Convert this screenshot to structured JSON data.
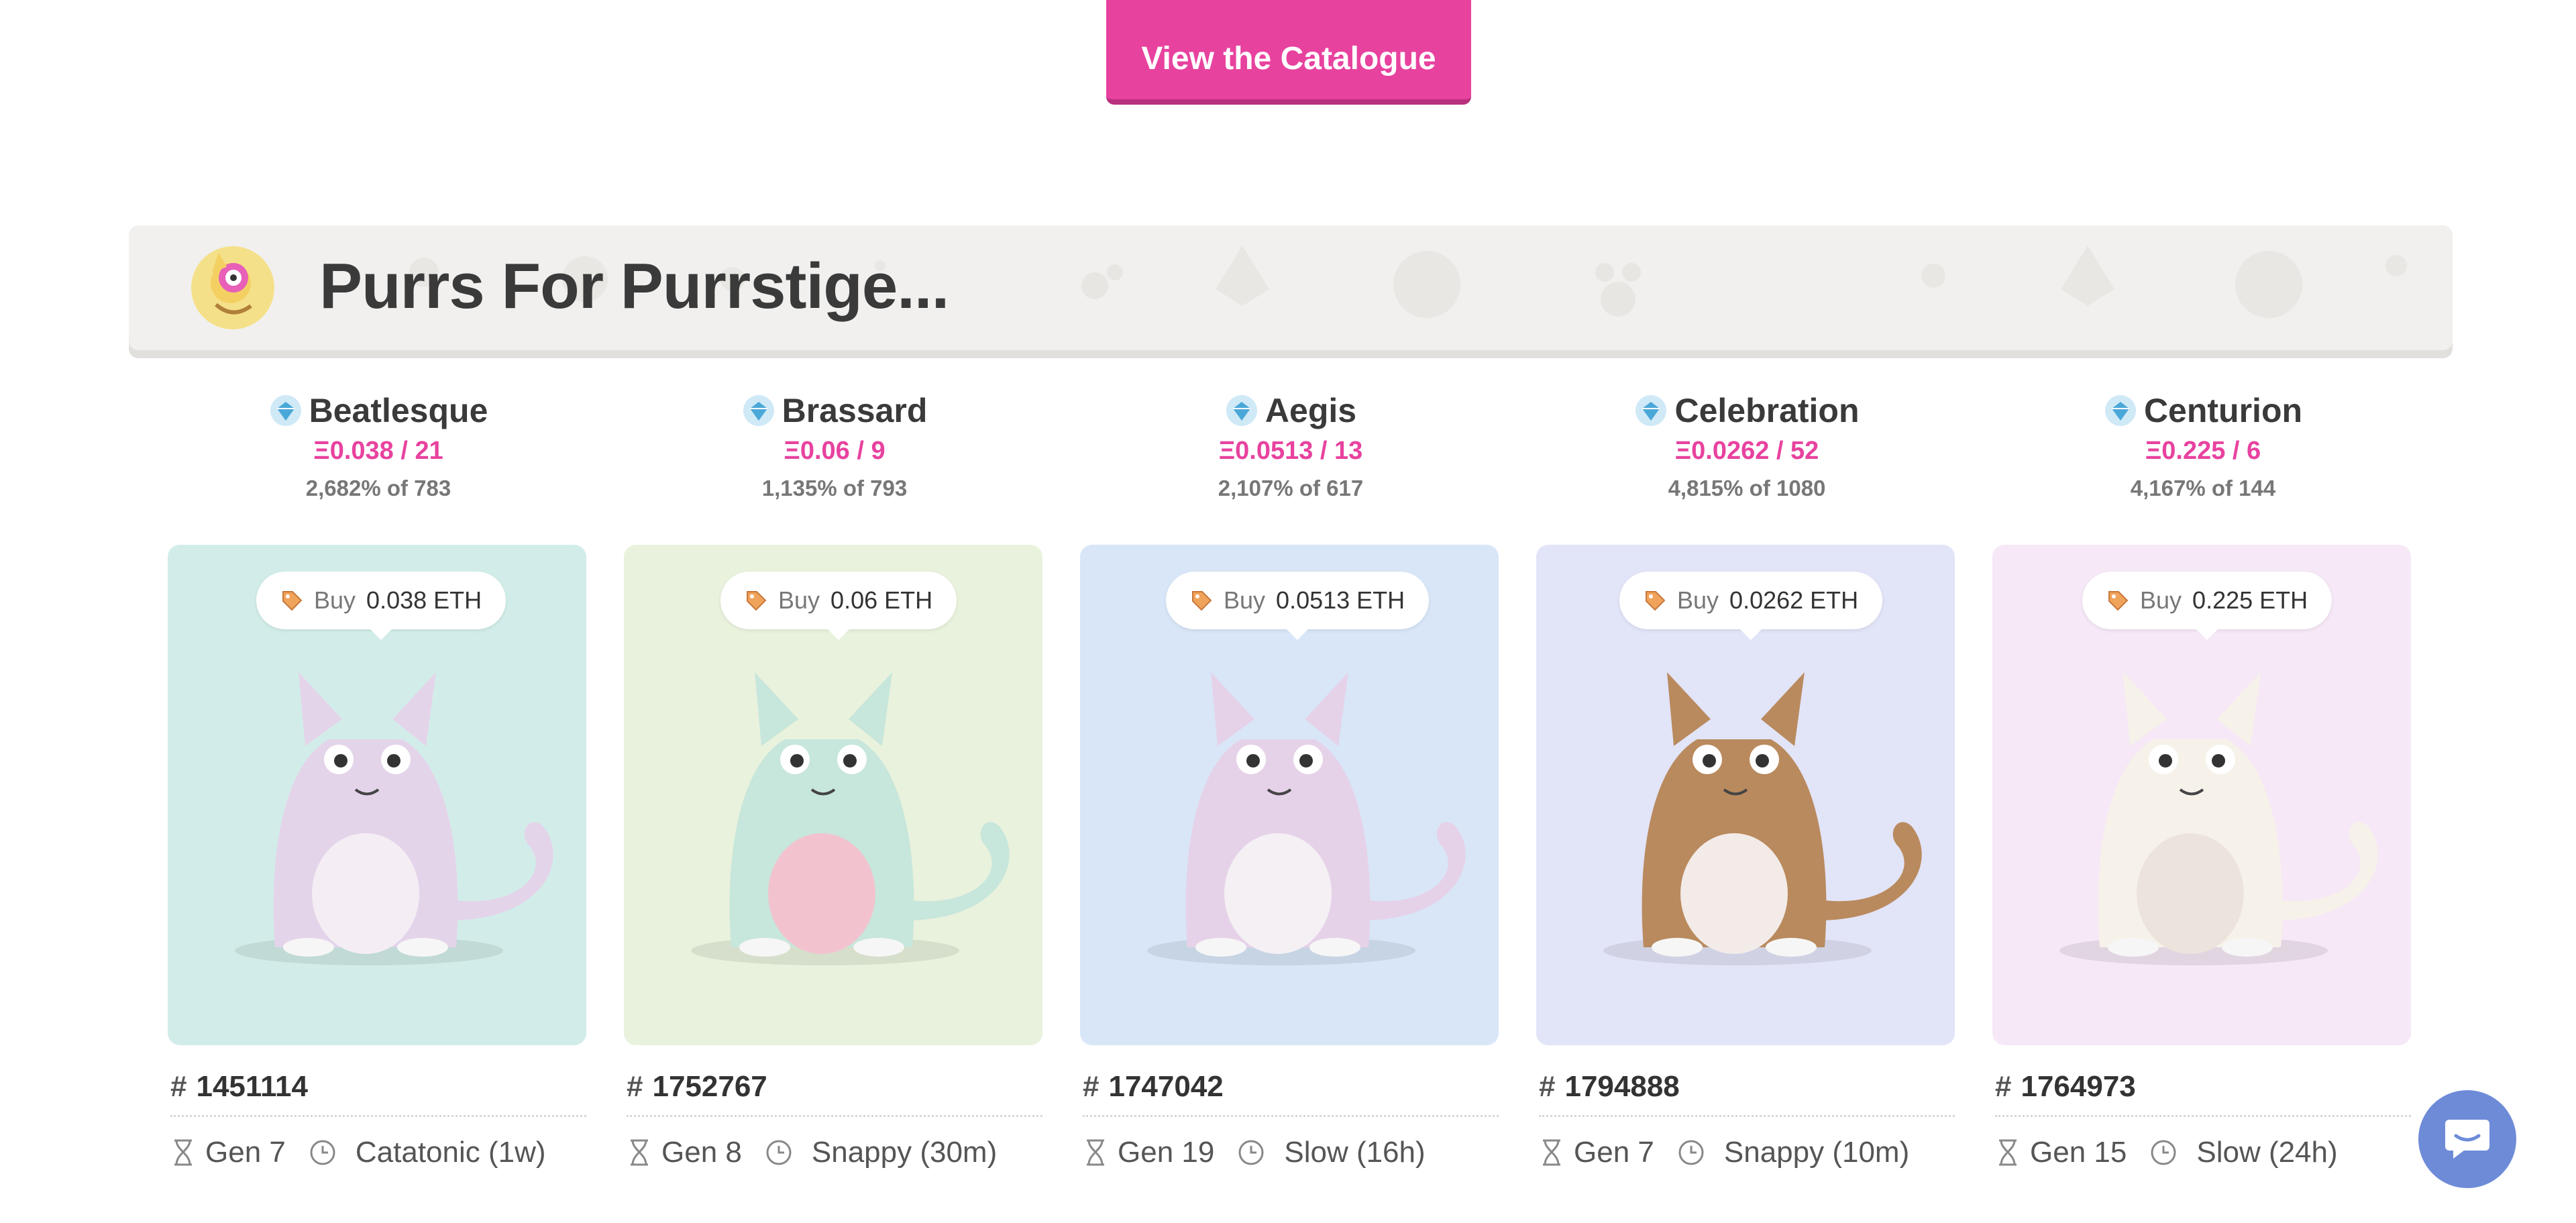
{
  "header": {
    "catalogue_button": "View the Catalogue"
  },
  "section": {
    "title": "Purrs For Purrstige..."
  },
  "colors": {
    "accent": "#e8429f",
    "chat": "#6e8bd8"
  },
  "cats": [
    {
      "name": "Beatlesque",
      "price_count": "Ξ0.038 / 21",
      "percent": "2,682% of 783",
      "buy_label": "Buy",
      "buy_price": "0.038 ETH",
      "id": "1451114",
      "gen": "Gen 7",
      "speed": "Catatonic (1w)",
      "bg": "#d2ede9",
      "body": "#e4d4ea",
      "accent": "#f4eef4"
    },
    {
      "name": "Brassard",
      "price_count": "Ξ0.06 / 9",
      "percent": "1,135% of 793",
      "buy_label": "Buy",
      "buy_price": "0.06 ETH",
      "id": "1752767",
      "gen": "Gen 8",
      "speed": "Snappy (30m)",
      "bg": "#e9f2dd",
      "body": "#c7e6dc",
      "accent": "#f2c3cf"
    },
    {
      "name": "Aegis",
      "price_count": "Ξ0.0513 / 13",
      "percent": "2,107% of 617",
      "buy_label": "Buy",
      "buy_price": "0.0513 ETH",
      "id": "1747042",
      "gen": "Gen 19",
      "speed": "Slow (16h)",
      "bg": "#d8e6f8",
      "body": "#e6d2e8",
      "accent": "#f4f0f4"
    },
    {
      "name": "Celebration",
      "price_count": "Ξ0.0262 / 52",
      "percent": "4,815% of 1080",
      "buy_label": "Buy",
      "buy_price": "0.0262 ETH",
      "id": "1794888",
      "gen": "Gen 7",
      "speed": "Snappy (10m)",
      "bg": "#e2e4f8",
      "body": "#b98a5e",
      "accent": "#f2ebe8"
    },
    {
      "name": "Centurion",
      "price_count": "Ξ0.225 / 6",
      "percent": "4,167% of 144",
      "buy_label": "Buy",
      "buy_price": "0.225 ETH",
      "id": "1764973",
      "gen": "Gen 15",
      "speed": "Slow (24h)",
      "bg": "#f6e8f6",
      "body": "#f6f2ea",
      "accent": "#ece4dc"
    }
  ]
}
